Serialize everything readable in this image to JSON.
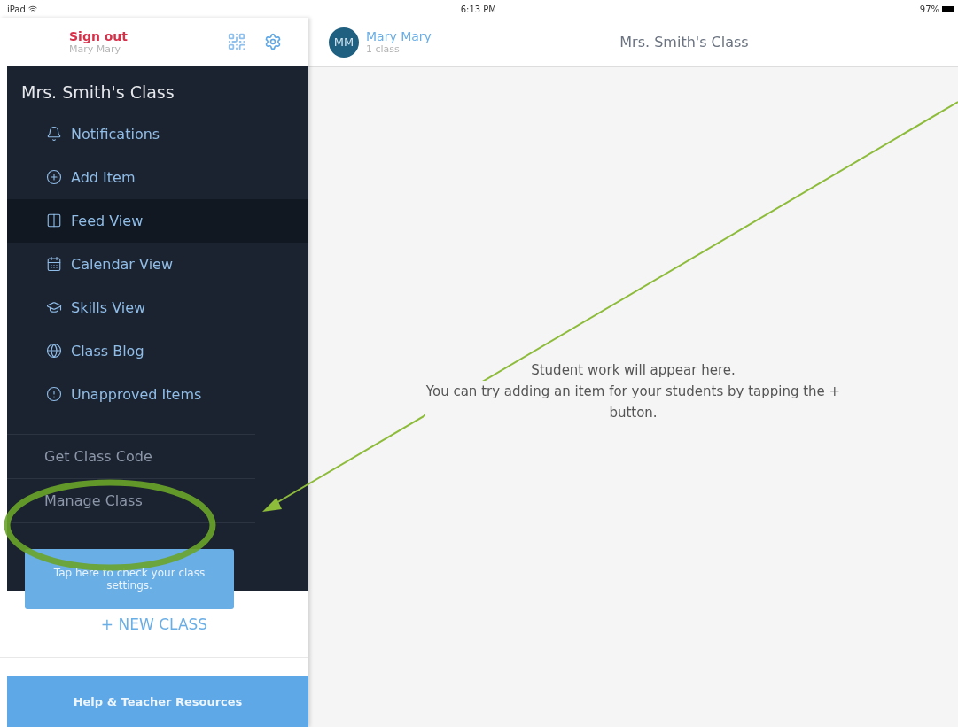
{
  "status_bar": {
    "carrier": "iPad",
    "time": "6:13 PM",
    "battery": "97%"
  },
  "sidebar": {
    "sign_out": "Sign out",
    "user": "Mary Mary",
    "class_title": "Mrs. Smith's Class",
    "items": [
      {
        "label": "Notifications",
        "kind": "bell",
        "selected": false
      },
      {
        "label": "Add Item",
        "kind": "add",
        "selected": false
      },
      {
        "label": "Feed View",
        "kind": "columns",
        "selected": true
      },
      {
        "label": "Calendar View",
        "kind": "calendar",
        "selected": false
      },
      {
        "label": "Skills View",
        "kind": "cap",
        "selected": false
      },
      {
        "label": "Class Blog",
        "kind": "globe",
        "selected": false
      },
      {
        "label": "Unapproved Items",
        "kind": "alert",
        "selected": false
      }
    ],
    "secondary_items": [
      "Get Class Code",
      "Manage Class"
    ],
    "tooltip": "Tap here to check your class settings.",
    "new_class": "+ NEW CLASS",
    "help_button": "Help & Teacher Resources"
  },
  "header": {
    "avatar": "MM",
    "name": "Mary Mary",
    "subtitle": "1 class",
    "title": "Mrs. Smith's Class"
  },
  "empty_state": {
    "lines": [
      "Student work will appear here.",
      "You can try adding an item for your students by tapping the + button."
    ]
  }
}
